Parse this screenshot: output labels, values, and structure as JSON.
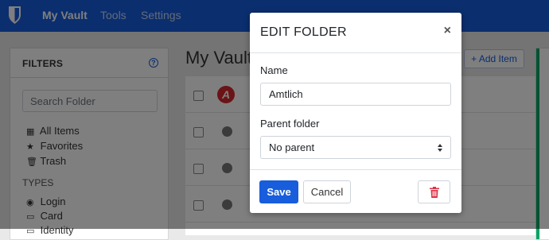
{
  "nav": {
    "brand_icon": "bitwarden-shield-icon",
    "items": [
      {
        "label": "My Vault",
        "active": true
      },
      {
        "label": "Tools",
        "active": false
      },
      {
        "label": "Settings",
        "active": false
      }
    ]
  },
  "filters": {
    "title": "FILTERS",
    "help_icon": "question-circle-icon",
    "search_placeholder": "Search Folder",
    "items": [
      {
        "label": "All Items",
        "icon": "grid-icon",
        "icon_glyph": "▦"
      },
      {
        "label": "Favorites",
        "icon": "star-icon",
        "icon_glyph": "★"
      },
      {
        "label": "Trash",
        "icon": "trash-icon",
        "icon_glyph": "🗑"
      }
    ],
    "types_label": "TYPES",
    "types": [
      {
        "label": "Login",
        "icon": "globe-icon",
        "icon_glyph": "◉"
      },
      {
        "label": "Card",
        "icon": "credit-card-icon",
        "icon_glyph": "▭"
      },
      {
        "label": "Identity",
        "icon": "id-card-icon",
        "icon_glyph": "▭"
      }
    ]
  },
  "vault": {
    "title": "My Vault",
    "add_item_label": "+ Add Item"
  },
  "modal": {
    "title": "EDIT FOLDER",
    "close_glyph": "×",
    "name_label": "Name",
    "name_value": "Amtlich",
    "parent_label": "Parent folder",
    "parent_value": "No parent",
    "save_label": "Save",
    "cancel_label": "Cancel",
    "delete_icon": "trash-icon"
  },
  "colors": {
    "brand": "#175ddc",
    "danger": "#dc3545",
    "success": "#01a665"
  }
}
